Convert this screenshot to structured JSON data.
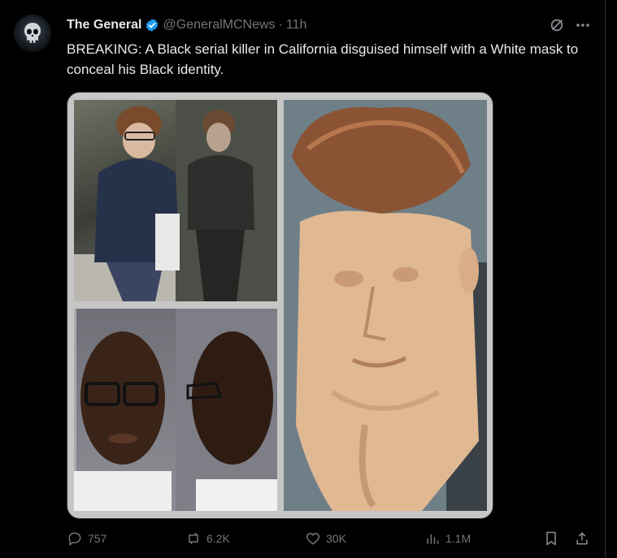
{
  "post": {
    "display_name": "The General",
    "handle": "@GeneralMCNews",
    "separator": "·",
    "time": "11h",
    "text": "BREAKING: A Black serial killer in California disguised himself with a White mask to conceal his Black identity."
  },
  "actions": {
    "replies": "757",
    "reposts": "6.2K",
    "likes": "30K",
    "views": "1.1M"
  },
  "icons": {
    "verified": "verified-badge-icon",
    "grok": "grok-icon",
    "more": "more-dots-icon",
    "reply": "reply-icon",
    "repost": "repost-icon",
    "like": "heart-icon",
    "views": "views-chart-icon",
    "bookmark": "bookmark-icon",
    "share": "share-icon"
  },
  "colors": {
    "background": "#000000",
    "text": "#e7e9ea",
    "muted": "#71767b",
    "verified": "#1d9bf0"
  }
}
